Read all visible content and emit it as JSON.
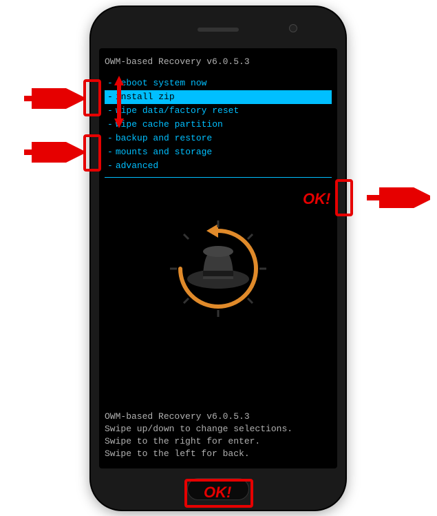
{
  "title": "OWM-based Recovery v6.0.5.3",
  "menu": [
    {
      "label": "reboot system now",
      "selected": false
    },
    {
      "label": "install zip",
      "selected": true
    },
    {
      "label": "wipe data/factory reset",
      "selected": false
    },
    {
      "label": "wipe cache partition",
      "selected": false
    },
    {
      "label": "backup and restore",
      "selected": false
    },
    {
      "label": "mounts and storage",
      "selected": false
    },
    {
      "label": "advanced",
      "selected": false
    }
  ],
  "footer": {
    "line1": "OWM-based Recovery v6.0.5.3",
    "line2": "Swipe up/down to change selections.",
    "line3": "Swipe to the right for enter.",
    "line4": "Swipe to the left for back."
  },
  "annotations": {
    "ok": "OK!"
  },
  "colors": {
    "accent": "#00bfff",
    "callout": "#e60000",
    "muted": "#b0b0b0"
  }
}
